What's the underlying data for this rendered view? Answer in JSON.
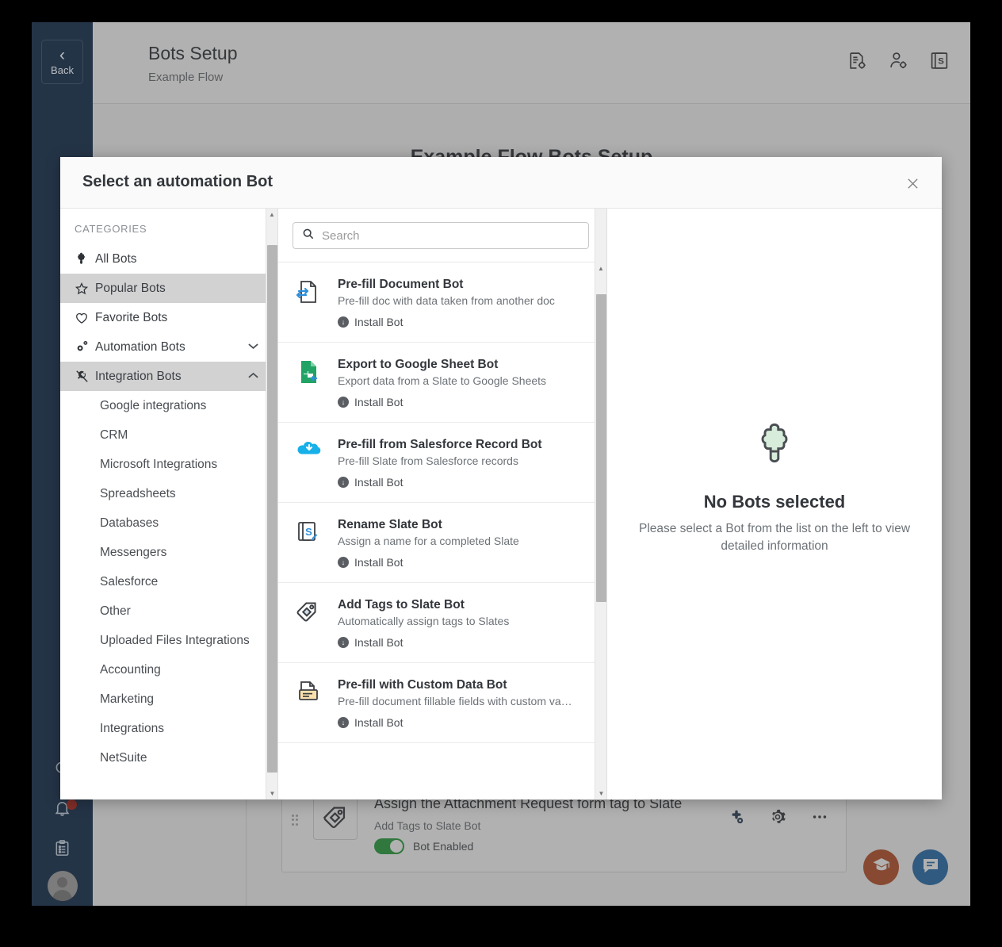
{
  "app": {
    "back_label": "Back",
    "page_title": "Bots Setup",
    "page_subtitle": "Example Flow",
    "content_title": "Example Flow Bots Setup",
    "header_icons": [
      {
        "name": "document-settings-icon"
      },
      {
        "name": "user-settings-icon"
      },
      {
        "name": "slate-icon"
      }
    ],
    "rail_icons": [
      {
        "name": "search-icon"
      },
      {
        "name": "notifications-bell-icon"
      },
      {
        "name": "clipboard-icon"
      },
      {
        "name": "avatar"
      }
    ]
  },
  "bot_card": {
    "title": "Assign the Attachment Request form tag to Slate",
    "subtitle": "Add Tags to Slate Bot",
    "toggle_label": "Bot Enabled",
    "toggle_on": true,
    "icon": "tag-icon",
    "actions": [
      {
        "name": "add-bot-icon"
      },
      {
        "name": "gear-icon"
      },
      {
        "name": "more-options-icon"
      }
    ]
  },
  "float_buttons": [
    {
      "name": "learning-center-button",
      "icon": "graduation-cap-icon",
      "color": "#b9532c"
    },
    {
      "name": "chat-support-button",
      "icon": "chat-bubble-icon",
      "color": "#2a6ead"
    }
  ],
  "modal": {
    "title": "Select an automation Bot",
    "close_label": "×",
    "categories_label": "CATEGORIES",
    "categories": [
      {
        "label": "All Bots",
        "icon": "puzzle-piece-icon",
        "active": false,
        "expandable": false
      },
      {
        "label": "Popular Bots",
        "icon": "star-icon",
        "active": true,
        "expandable": false
      },
      {
        "label": "Favorite Bots",
        "icon": "heart-icon",
        "active": false,
        "expandable": false
      },
      {
        "label": "Automation Bots",
        "icon": "gears-icon",
        "active": false,
        "expandable": true,
        "expanded": false
      },
      {
        "label": "Integration Bots",
        "icon": "plug-icon",
        "active": true,
        "expandable": true,
        "expanded": true
      }
    ],
    "subcategories": [
      {
        "label": "Google integrations"
      },
      {
        "label": "CRM"
      },
      {
        "label": "Microsoft Integrations"
      },
      {
        "label": "Spreadsheets"
      },
      {
        "label": "Databases"
      },
      {
        "label": "Messengers"
      },
      {
        "label": "Salesforce"
      },
      {
        "label": "Other"
      },
      {
        "label": "Uploaded Files Integrations"
      },
      {
        "label": "Accounting"
      },
      {
        "label": "Marketing"
      },
      {
        "label": "Integrations"
      },
      {
        "label": "NetSuite"
      }
    ],
    "search": {
      "placeholder": "Search",
      "value": ""
    },
    "install_label": "Install Bot",
    "bots": [
      {
        "name": "Pre-fill Document Bot",
        "description": "Pre-fill doc with data taken from another doc",
        "icon": "prefill-document-icon"
      },
      {
        "name": "Export to Google Sheet Bot",
        "description": "Export data from a Slate to Google Sheets",
        "icon": "google-sheet-icon"
      },
      {
        "name": "Pre-fill from Salesforce Record Bot",
        "description": "Pre-fill Slate from Salesforce records",
        "icon": "salesforce-cloud-icon"
      },
      {
        "name": "Rename Slate Bot",
        "description": "Assign a name for a completed Slate",
        "icon": "rename-slate-icon"
      },
      {
        "name": "Add Tags to Slate Bot",
        "description": "Automatically assign tags to Slates",
        "icon": "tag-icon"
      },
      {
        "name": "Pre-fill with Custom Data Bot",
        "description": "Pre-fill document fillable fields with custom va…",
        "icon": "custom-data-icon"
      }
    ],
    "details": {
      "empty_icon": "puzzle-piece-icon",
      "empty_title": "No Bots selected",
      "empty_description": "Please select a Bot from the list on the left to view detailed information"
    }
  },
  "colors": {
    "rail": "#2e4259",
    "accent_green": "#29a03f",
    "active_row": "#d2d2d2",
    "learn_orange": "#b9532c",
    "chat_blue": "#2a6ead"
  }
}
